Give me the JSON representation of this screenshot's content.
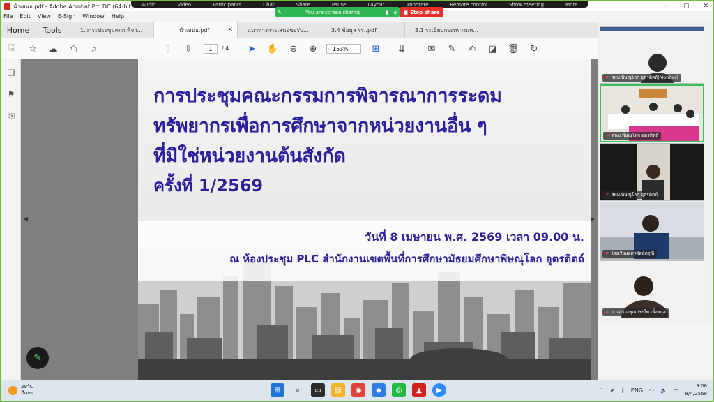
{
  "window": {
    "title": "นำเสนอ.pdf - Adobe Acrobat Pro DC (64-bit)",
    "minimize": "—",
    "maximize": "▢",
    "close": "✕"
  },
  "zoom_controls": {
    "items": [
      "Audio",
      "Video",
      "Participants",
      "Chat",
      "Share",
      "Pause",
      "Layout",
      "Annotate",
      "Remote control",
      "Show meeting",
      "More"
    ],
    "sharing_text": "You are screen sharing",
    "stop_share": "Stop share"
  },
  "menu": [
    "File",
    "Edit",
    "View",
    "E-Sign",
    "Window",
    "Help"
  ],
  "tabs": {
    "home": "Home",
    "tools": "Tools",
    "documents": [
      {
        "label": "1.วาระประชุมคกก.พิจา...",
        "active": false
      },
      {
        "label": "นำเสนอ.pdf",
        "active": true
      },
      {
        "label": "แนวทางการเสนอขอรับ...",
        "active": false
      },
      {
        "label": "3.4 ข้อมูล รร..pdf",
        "active": false
      },
      {
        "label": "3.1 ระเบียบกระทรวงมห...",
        "active": false
      }
    ],
    "close_glyph": "✕"
  },
  "toolbar": {
    "current_page": "1",
    "total_pages": "/ 4",
    "zoom": "153%"
  },
  "slide": {
    "title_line1": "การประชุมคณะกรรมการพิจารณาการระดม",
    "title_line2": "ทรัพยากรเพื่อการศึกษาจากหน่วยงานอื่น ๆ",
    "title_line3": "ที่มิใช่หน่วยงานต้นสังกัด",
    "session": "ครั้งที่ 1/2569",
    "date": "วันที่ 8 เมษายน พ.ศ. 2569 เวลา 09.00 น.",
    "venue": "ณ ห้องประชุม PLC  สำนักงานเขตพื้นที่การศึกษามัธยมศึกษาพิษณุโลก อุตรดิตถ์"
  },
  "participants": [
    {
      "name": "สพม.พิษณุโลก อุตรดิตถ์(Monitor)",
      "speaking": false
    },
    {
      "name": "สพม.พิษณุโลก อุตรดิตถ์",
      "speaking": true
    },
    {
      "name": "สพม.พิษณุโลก อุตรดิตถ์",
      "speaking": false
    },
    {
      "name": "โรงเรียนอุตรดิตถ์ดรุณี",
      "speaking": false
    },
    {
      "name": "นางสาวอรุณประไพ เพ็งสกุล",
      "speaking": false
    }
  ],
  "taskbar": {
    "temperature": "29°C",
    "weather_text": "มีเมฆ",
    "language": "ENG",
    "time": "9:06",
    "date": "8/4/2569"
  },
  "colors": {
    "slide_title": "#2b1f9c",
    "share_green": "#2fb551",
    "stop_red": "#e5312a",
    "outer_border": "#6fbf3a"
  }
}
